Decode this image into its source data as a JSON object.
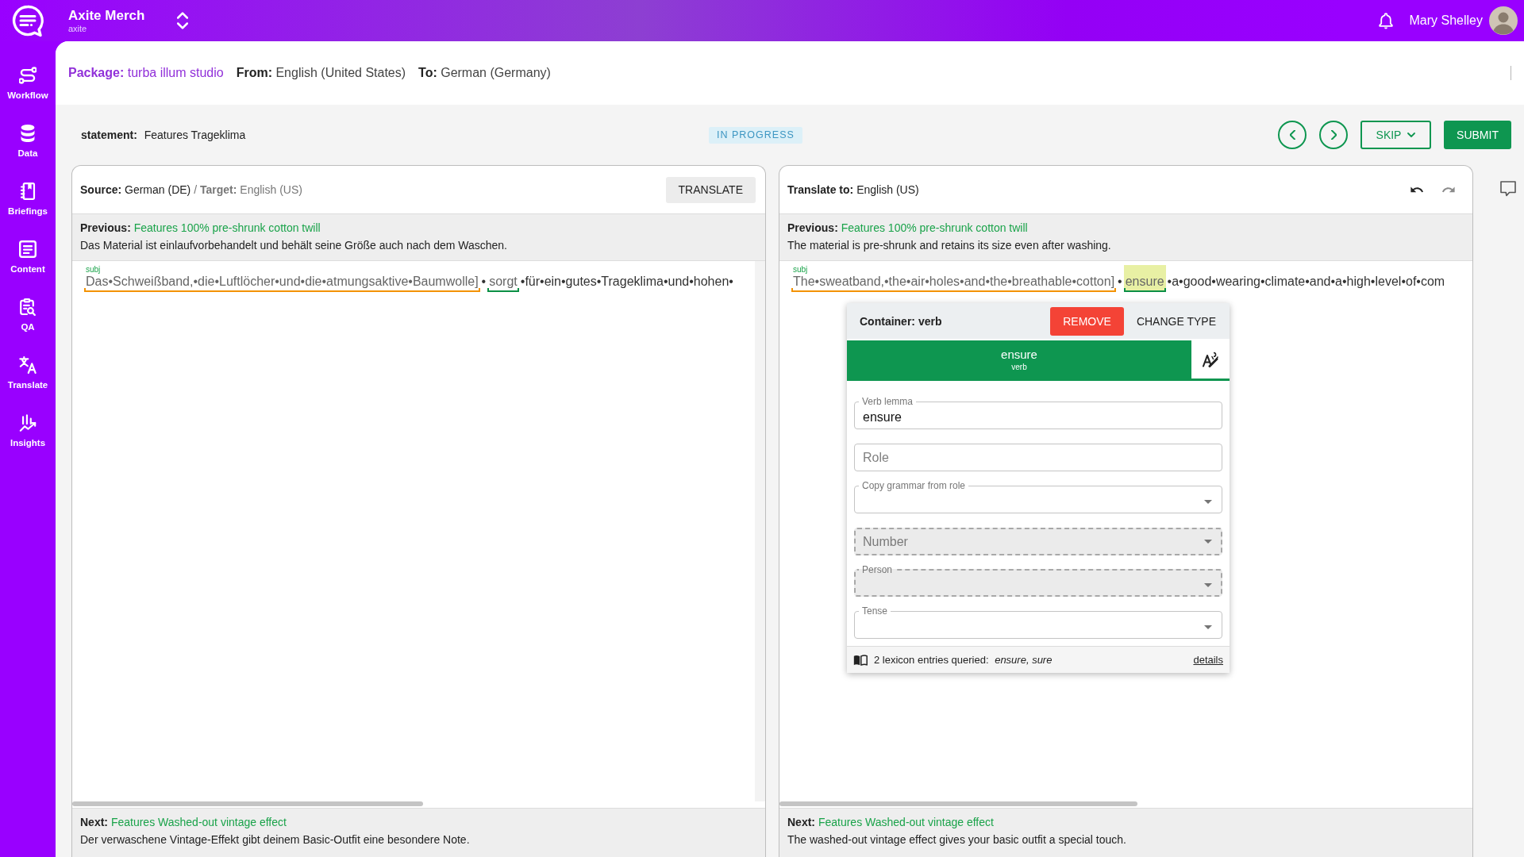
{
  "app_bar": {
    "title": "Axite Merch",
    "subtitle": "axite",
    "user_name": "Mary Shelley"
  },
  "sidebar": {
    "items": [
      {
        "label": "Workflow"
      },
      {
        "label": "Data"
      },
      {
        "label": "Briefings"
      },
      {
        "label": "Content"
      },
      {
        "label": "QA"
      },
      {
        "label": "Translate"
      },
      {
        "label": "Insights"
      }
    ]
  },
  "package_bar": {
    "package": "**Package:** turba illum studio",
    "from": "**From:** English (United States)",
    "to": "**To:** German (Germany)"
  },
  "task_bar": {
    "statement": "**statement:** Features Trageklima",
    "status": "IN PROGRESS",
    "skip_button": "SKIP",
    "submit_button": "SUBMIT"
  },
  "source_panel": {
    "source": "**Source:** German (DE)",
    "target": "/ **Target:** English (US)",
    "translate_button": "TRANSLATE",
    "previous": {
      "title": "**Previous:** Features 100% pre-shrunk cotton twill",
      "text": "Das Material ist einlaufvorbehandelt und behält seine Größe auch nach dem Waschen."
    },
    "segments": [
      {
        "kind": "container",
        "label": "subj",
        "text": "Das•Schweißband,•die•Luftlöcher•und•die•atmungsaktive•Baumwolle]",
        "color": "#f39200",
        "selected": false
      },
      {
        "kind": "plain",
        "text": "•"
      },
      {
        "kind": "container",
        "text": "sorgt",
        "color": "#0b8f45",
        "selected": false
      },
      {
        "kind": "plain",
        "text": "•für•ein•gutes•Trageklima•und•hohen•"
      }
    ],
    "next": {
      "title": "**Next:** Features Washed-out vintage effect",
      "text": "Der verwaschene Vintage-Effekt gibt deinem Basic-Outfit eine besondere Note."
    }
  },
  "target_panel": {
    "title": "**Translate to:** English (US)",
    "history_buttons": [
      {
        "kind": "undo",
        "disabled": false
      },
      {
        "kind": "redo",
        "disabled": true
      }
    ],
    "previous": {
      "title": "**Previous:** Features 100% pre-shrunk cotton twill",
      "text": "The material is pre-shrunk and retains its size even after washing."
    },
    "segments": [
      {
        "kind": "container",
        "label": "subj",
        "text": "The•sweatband,•the•air•holes•and•the•breathable•cotton]",
        "color": "#f39200",
        "selected": false
      },
      {
        "kind": "plain",
        "text": "•"
      },
      {
        "kind": "container",
        "text": "ensure",
        "color": "#0b8f45",
        "selected": true
      },
      {
        "kind": "plain",
        "text": "•a•good•wearing•climate•and•a•high•level•of•com"
      }
    ],
    "next": {
      "title": "**Next:** Features Washed-out vintage effect",
      "text": "The washed-out vintage effect gives your basic outfit a special touch."
    }
  },
  "container_editor": {
    "title": "Container: verb",
    "remove_button": "REMOVE",
    "change_type_button": "CHANGE TYPE",
    "word": "ensure",
    "word_type": "verb",
    "fields": [
      {
        "kind": "text",
        "label": "Verb lemma",
        "value": "ensure",
        "disabled": false
      },
      {
        "kind": "text",
        "placeholder": "Role",
        "disabled": false
      },
      {
        "kind": "select",
        "label": "Copy grammar from role",
        "disabled": false
      },
      {
        "kind": "select",
        "placeholder": "Number",
        "disabled": true
      },
      {
        "kind": "select",
        "label": "Person",
        "disabled": true
      },
      {
        "kind": "select",
        "label": "Tense",
        "disabled": false
      }
    ],
    "lexicon_summary": "2 lexicon entries queried: *ensure, sure*",
    "details_link": "details"
  }
}
